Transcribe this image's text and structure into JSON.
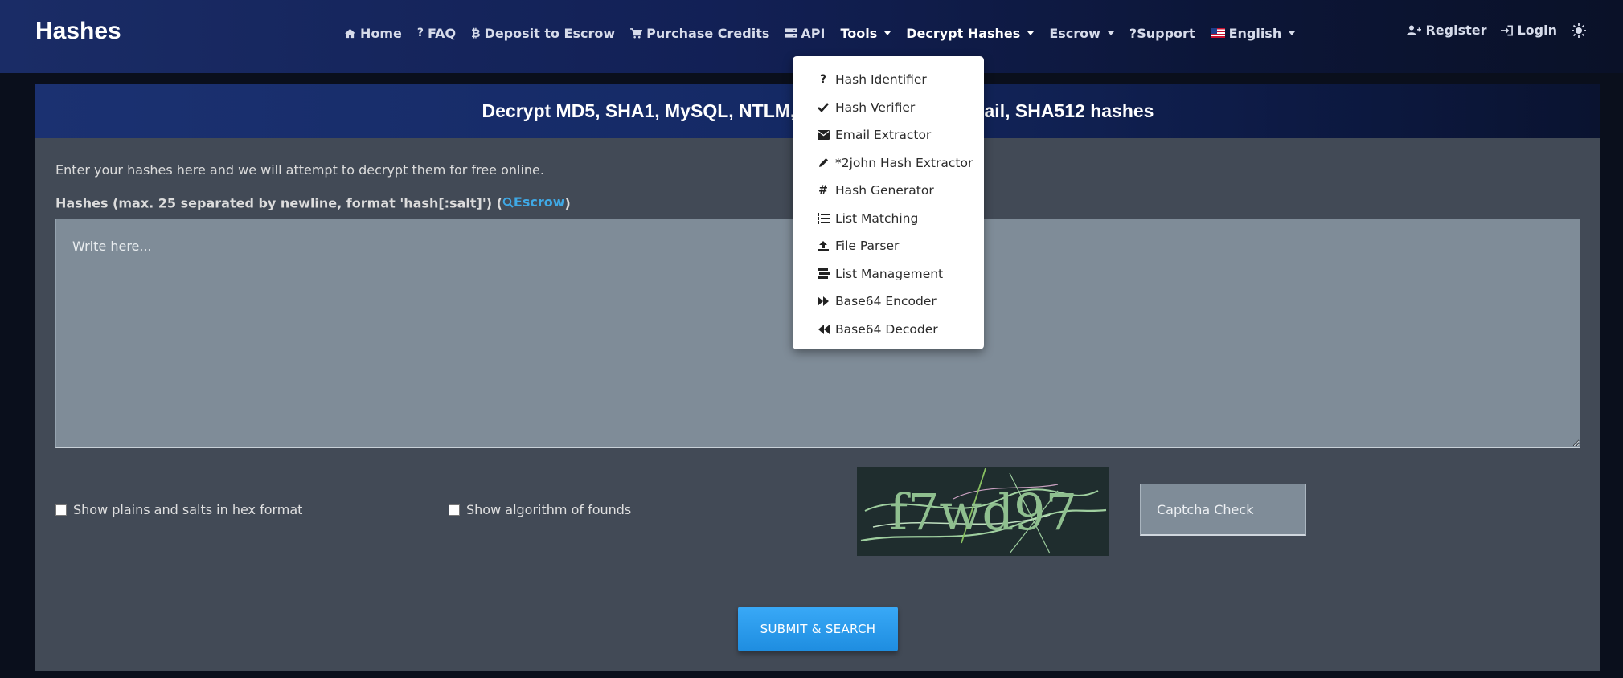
{
  "brand": "Hashes",
  "nav": {
    "home": "Home",
    "faq": "FAQ",
    "deposit": "Deposit to Escrow",
    "purchase": "Purchase Credits",
    "api": "API",
    "tools": "Tools",
    "decrypt": "Decrypt Hashes",
    "escrow": "Escrow",
    "support": "?Support",
    "language": "English",
    "register": "Register",
    "login": "Login"
  },
  "card": {
    "title": "Decrypt MD5, SHA1, MySQL, NTLM, SHA256, SHA256 Email, SHA512 hashes",
    "intro": "Enter your hashes here and we will attempt to decrypt them for free online.",
    "hashes_label": "Hashes (max. 25 separated by newline, format 'hash[:salt]') (",
    "hashes_label_end": ")",
    "escrow_link": "Escrow",
    "textarea_placeholder": "Write here...",
    "hex_label": "Show plains and salts in hex format",
    "algo_label": "Show algorithm of founds",
    "captcha_text": "f7wd97",
    "captcha_placeholder": "Captcha Check",
    "submit": "SUBMIT & SEARCH"
  },
  "tools_menu": [
    {
      "label": "Hash Identifier",
      "icon": "question-icon"
    },
    {
      "label": "Hash Verifier",
      "icon": "check-icon"
    },
    {
      "label": "Email Extractor",
      "icon": "envelope-icon"
    },
    {
      "label": "*2john Hash Extractor",
      "icon": "pencil-icon"
    },
    {
      "label": "Hash Generator",
      "icon": "hashtag-icon"
    },
    {
      "label": "List Matching",
      "icon": "list-ol-icon"
    },
    {
      "label": "File Parser",
      "icon": "upload-icon"
    },
    {
      "label": "List Management",
      "icon": "stream-icon"
    },
    {
      "label": "Base64 Encoder",
      "icon": "forward-icon"
    },
    {
      "label": "Base64 Decoder",
      "icon": "backward-icon"
    }
  ],
  "colors": {
    "navbar": "#122055",
    "card": "#424a56",
    "input": "#7f8c98",
    "accent": "#3fa9e6",
    "button": "#2a9bed"
  }
}
